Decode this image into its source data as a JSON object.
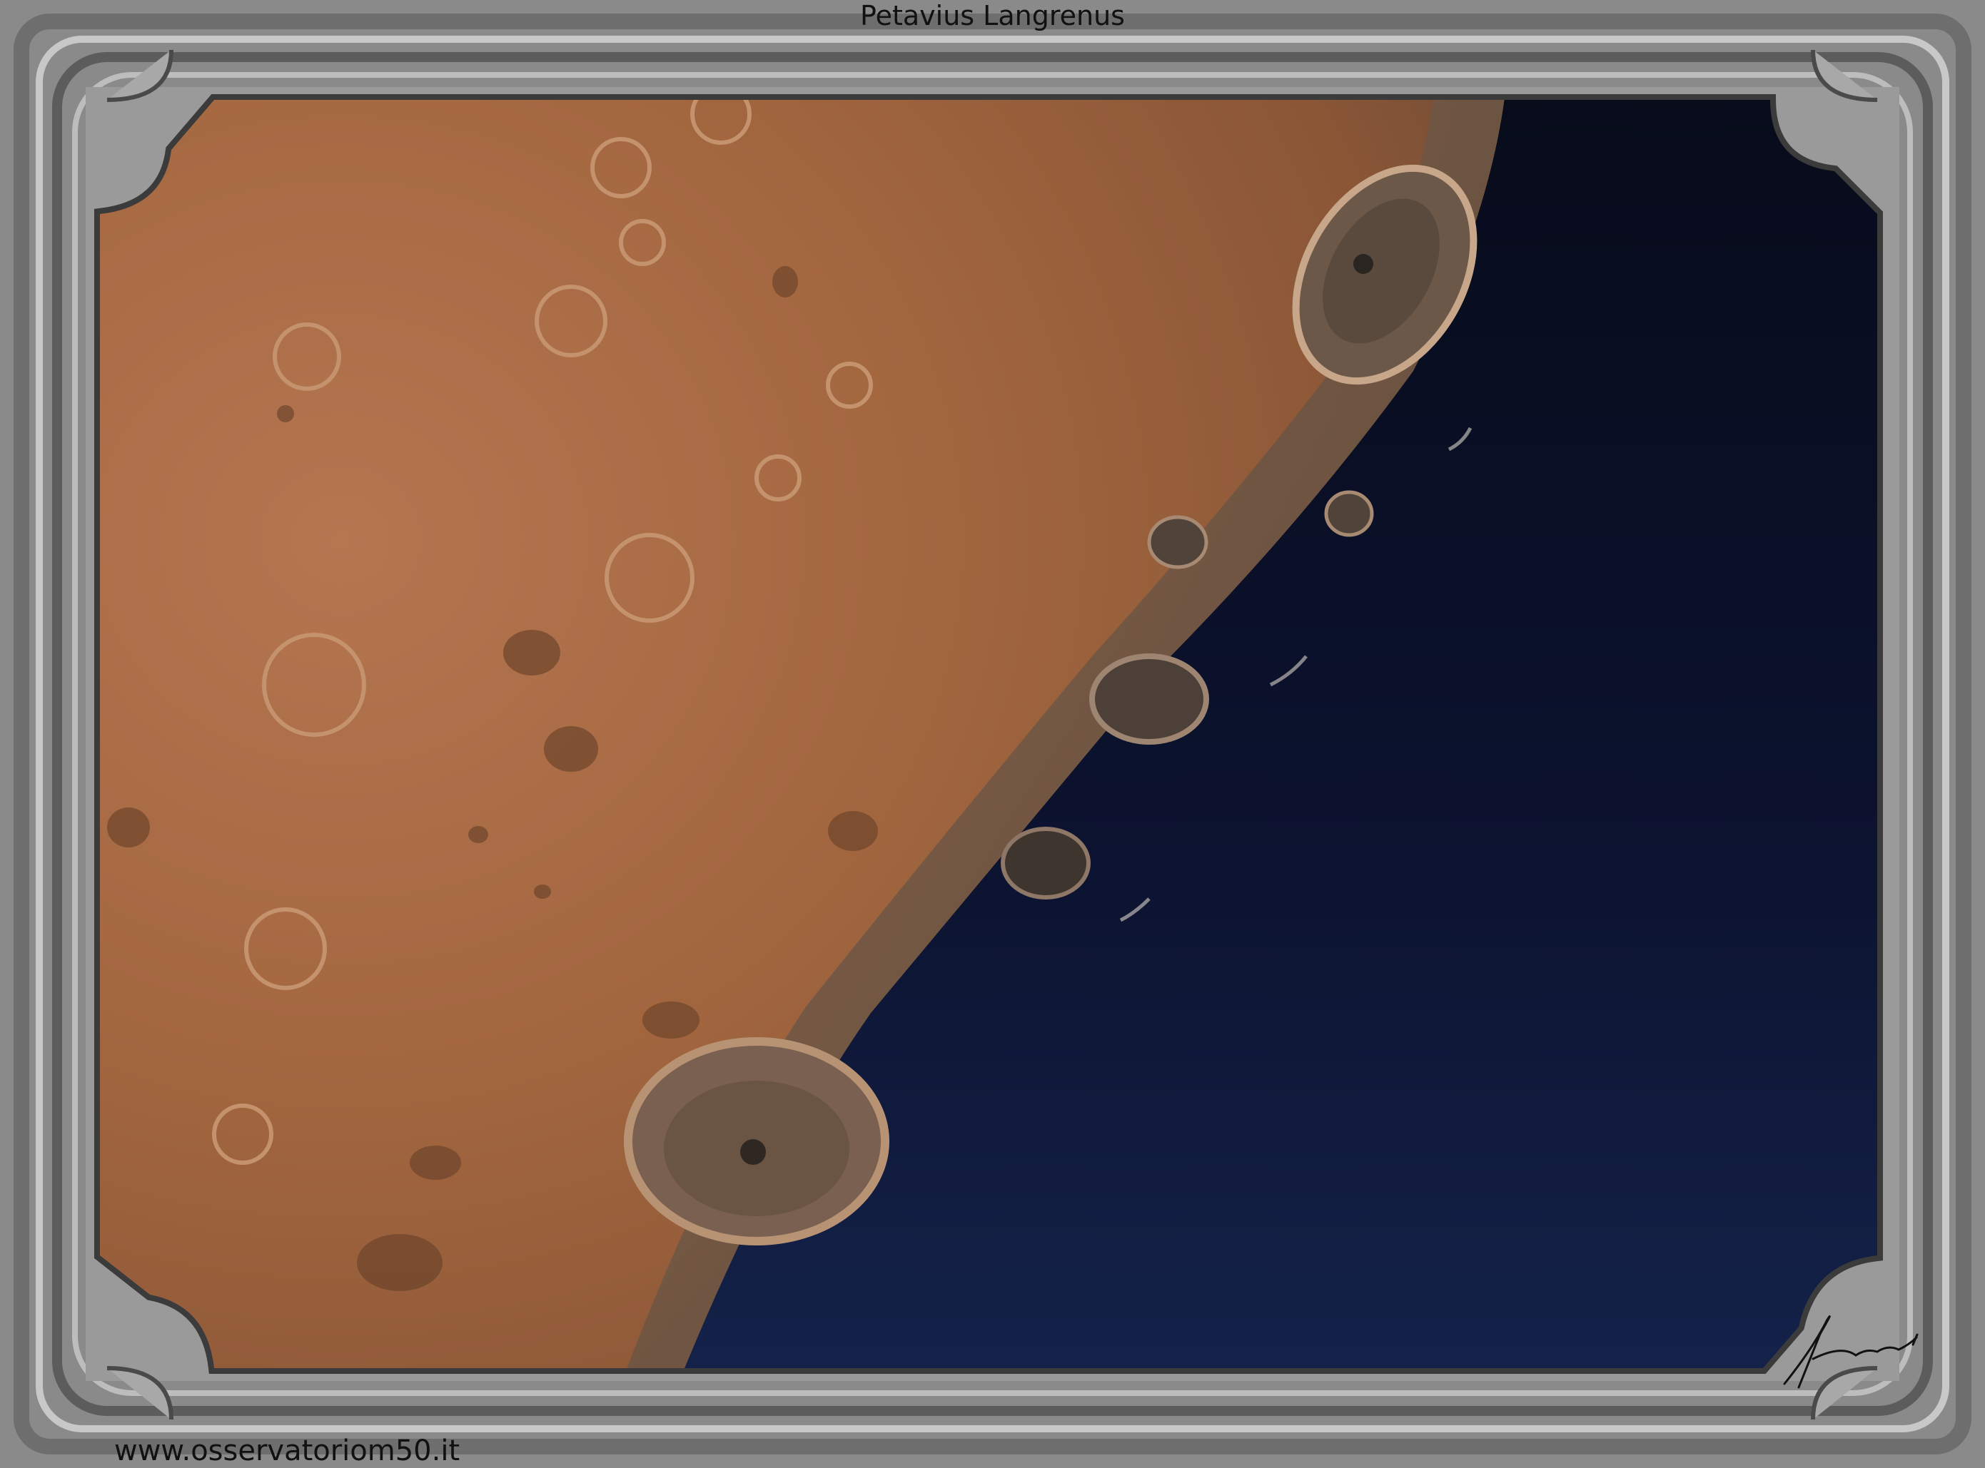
{
  "image": {
    "title": "Petavius Langrenus",
    "website": "www.osservatoriom50.it",
    "signature_text": "Marzavatti",
    "subject": "lunar-terminator-craters-photo"
  },
  "colors": {
    "frame_gray": "#8f8f8f",
    "frame_light": "#d0d0d0",
    "frame_dark": "#3a3a3a",
    "lunar_surface": "#a86a46",
    "space": "#0a1022"
  }
}
